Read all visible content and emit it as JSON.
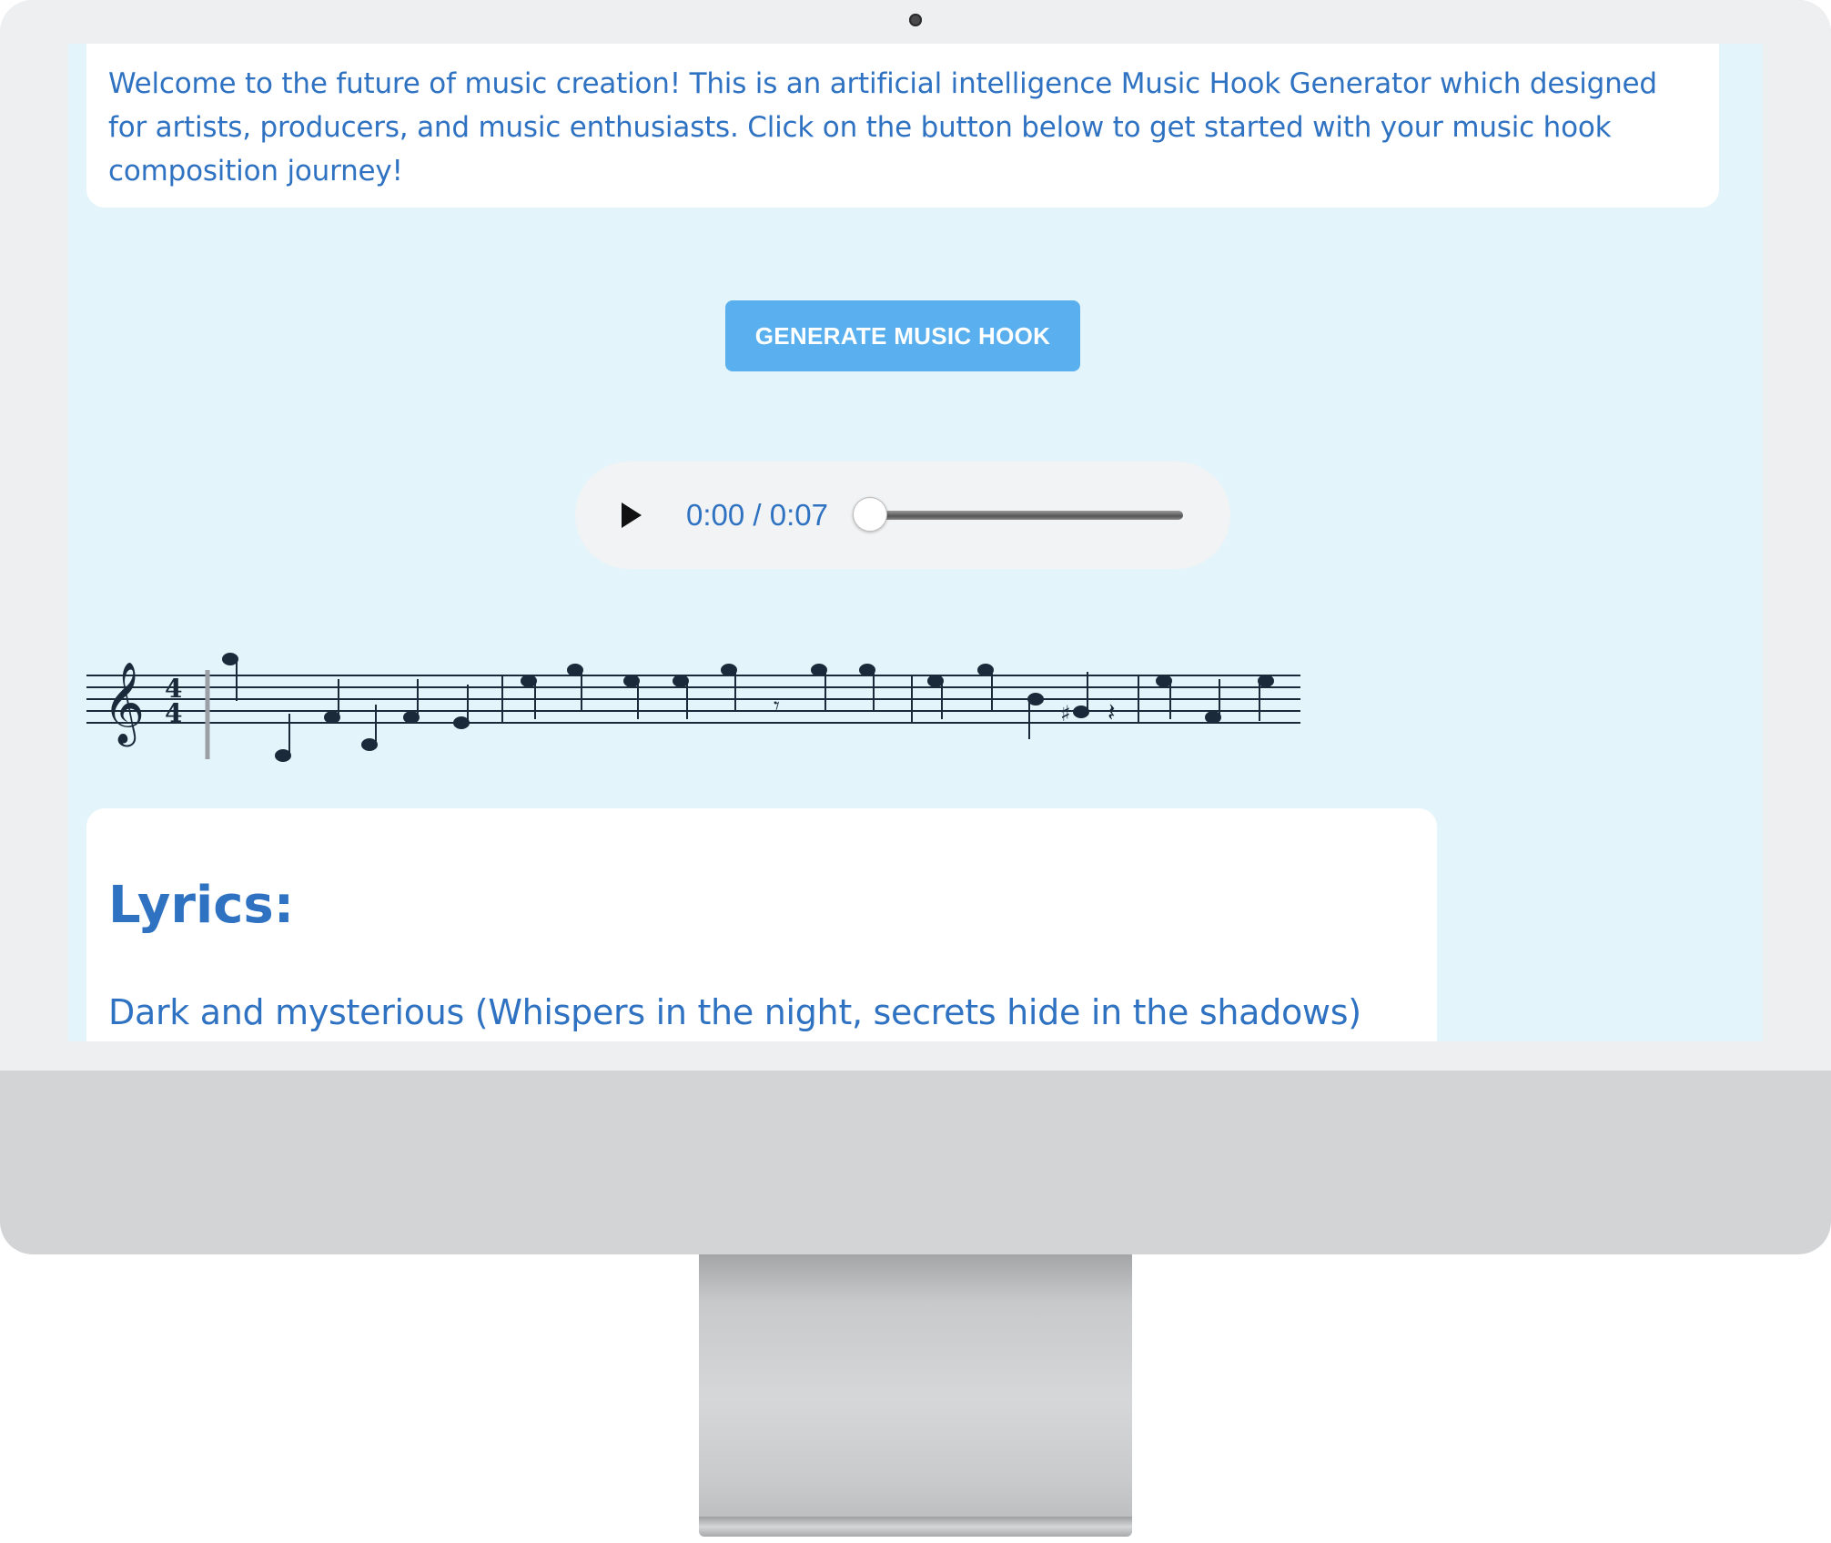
{
  "intro": {
    "text": "Welcome to the future of music creation! This is an artificial intelligence Music Hook Generator which designed for artists, producers, and music enthusiasts. Click on the button below to get started with your music hook composition journey!"
  },
  "generate_button": {
    "label": "GENERATE MUSIC HOOK"
  },
  "audio_player": {
    "time": "0:00 / 0:07",
    "progress": 0
  },
  "sheet_music": {
    "clef": "treble",
    "time_signature": "4/4"
  },
  "lyrics": {
    "heading": "Lyrics:",
    "first_line": "Dark and mysterious (Whispers in the night, secrets hide in the shadows)"
  },
  "colors": {
    "accent_text": "#2f72c2",
    "button": "#5ab0ee",
    "screen_background": "#e3f4fa"
  }
}
